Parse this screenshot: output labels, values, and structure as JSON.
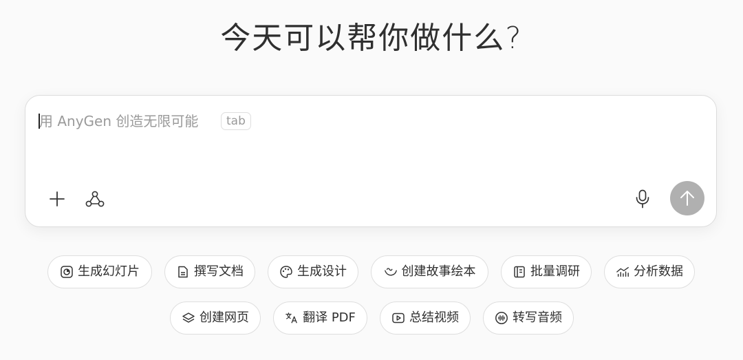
{
  "headline": "今天可以帮你做什么?",
  "composer": {
    "placeholder": "用 AnyGen 创造无限可能",
    "tab_hint": "tab"
  },
  "toolbar": {
    "add_icon": "plus-icon",
    "agent_icon": "graph-nodes-icon",
    "mic_icon": "microphone-icon",
    "send_icon": "arrow-up-icon",
    "send_color": "#b0b0b0"
  },
  "chips": {
    "slides": {
      "label": "生成幻灯片",
      "icon": "slides-icon"
    },
    "write_doc": {
      "label": "撰写文档",
      "icon": "document-icon"
    },
    "design": {
      "label": "生成设计",
      "icon": "palette-icon"
    },
    "story": {
      "label": "创建故事绘本",
      "icon": "story-icon"
    },
    "research": {
      "label": "批量调研",
      "icon": "research-icon"
    },
    "analytics": {
      "label": "分析数据",
      "icon": "chart-icon"
    },
    "webpage": {
      "label": "创建网页",
      "icon": "layers-icon"
    },
    "translate": {
      "label": "翻译 PDF",
      "icon": "translate-icon"
    },
    "video": {
      "label": "总结视频",
      "icon": "play-icon"
    },
    "audio": {
      "label": "转写音频",
      "icon": "audio-wave-icon"
    }
  }
}
